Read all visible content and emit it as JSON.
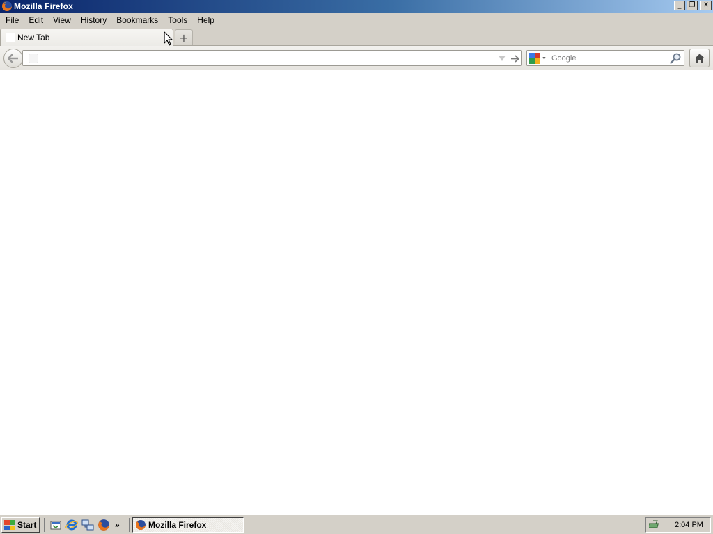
{
  "window": {
    "title": "Mozilla Firefox"
  },
  "window_controls": {
    "minimize": "_",
    "restore": "❐",
    "close": "✕"
  },
  "menu": [
    {
      "pre": "",
      "key": "F",
      "post": "ile"
    },
    {
      "pre": "",
      "key": "E",
      "post": "dit"
    },
    {
      "pre": "",
      "key": "V",
      "post": "iew"
    },
    {
      "pre": "Hi",
      "key": "s",
      "post": "tory"
    },
    {
      "pre": "",
      "key": "B",
      "post": "ookmarks"
    },
    {
      "pre": "",
      "key": "T",
      "post": "ools"
    },
    {
      "pre": "",
      "key": "H",
      "post": "elp"
    }
  ],
  "tabs": [
    {
      "label": "New Tab",
      "active": true
    }
  ],
  "new_tab_button": "+",
  "url_bar": {
    "value": "",
    "placeholder": ""
  },
  "search_bar": {
    "engine_icon": "google-icon",
    "placeholder": "Google",
    "value": ""
  },
  "taskbar": {
    "start_label": "Start",
    "quick_launch_more": "»",
    "tasks": [
      {
        "label": "Mozilla Firefox",
        "icon": "firefox-icon"
      }
    ],
    "clock": "2:04 PM"
  },
  "colors": {
    "title_gradient_start": "#0a246a",
    "title_gradient_end": "#a6caf0",
    "chrome_gray": "#d4d0c8"
  }
}
